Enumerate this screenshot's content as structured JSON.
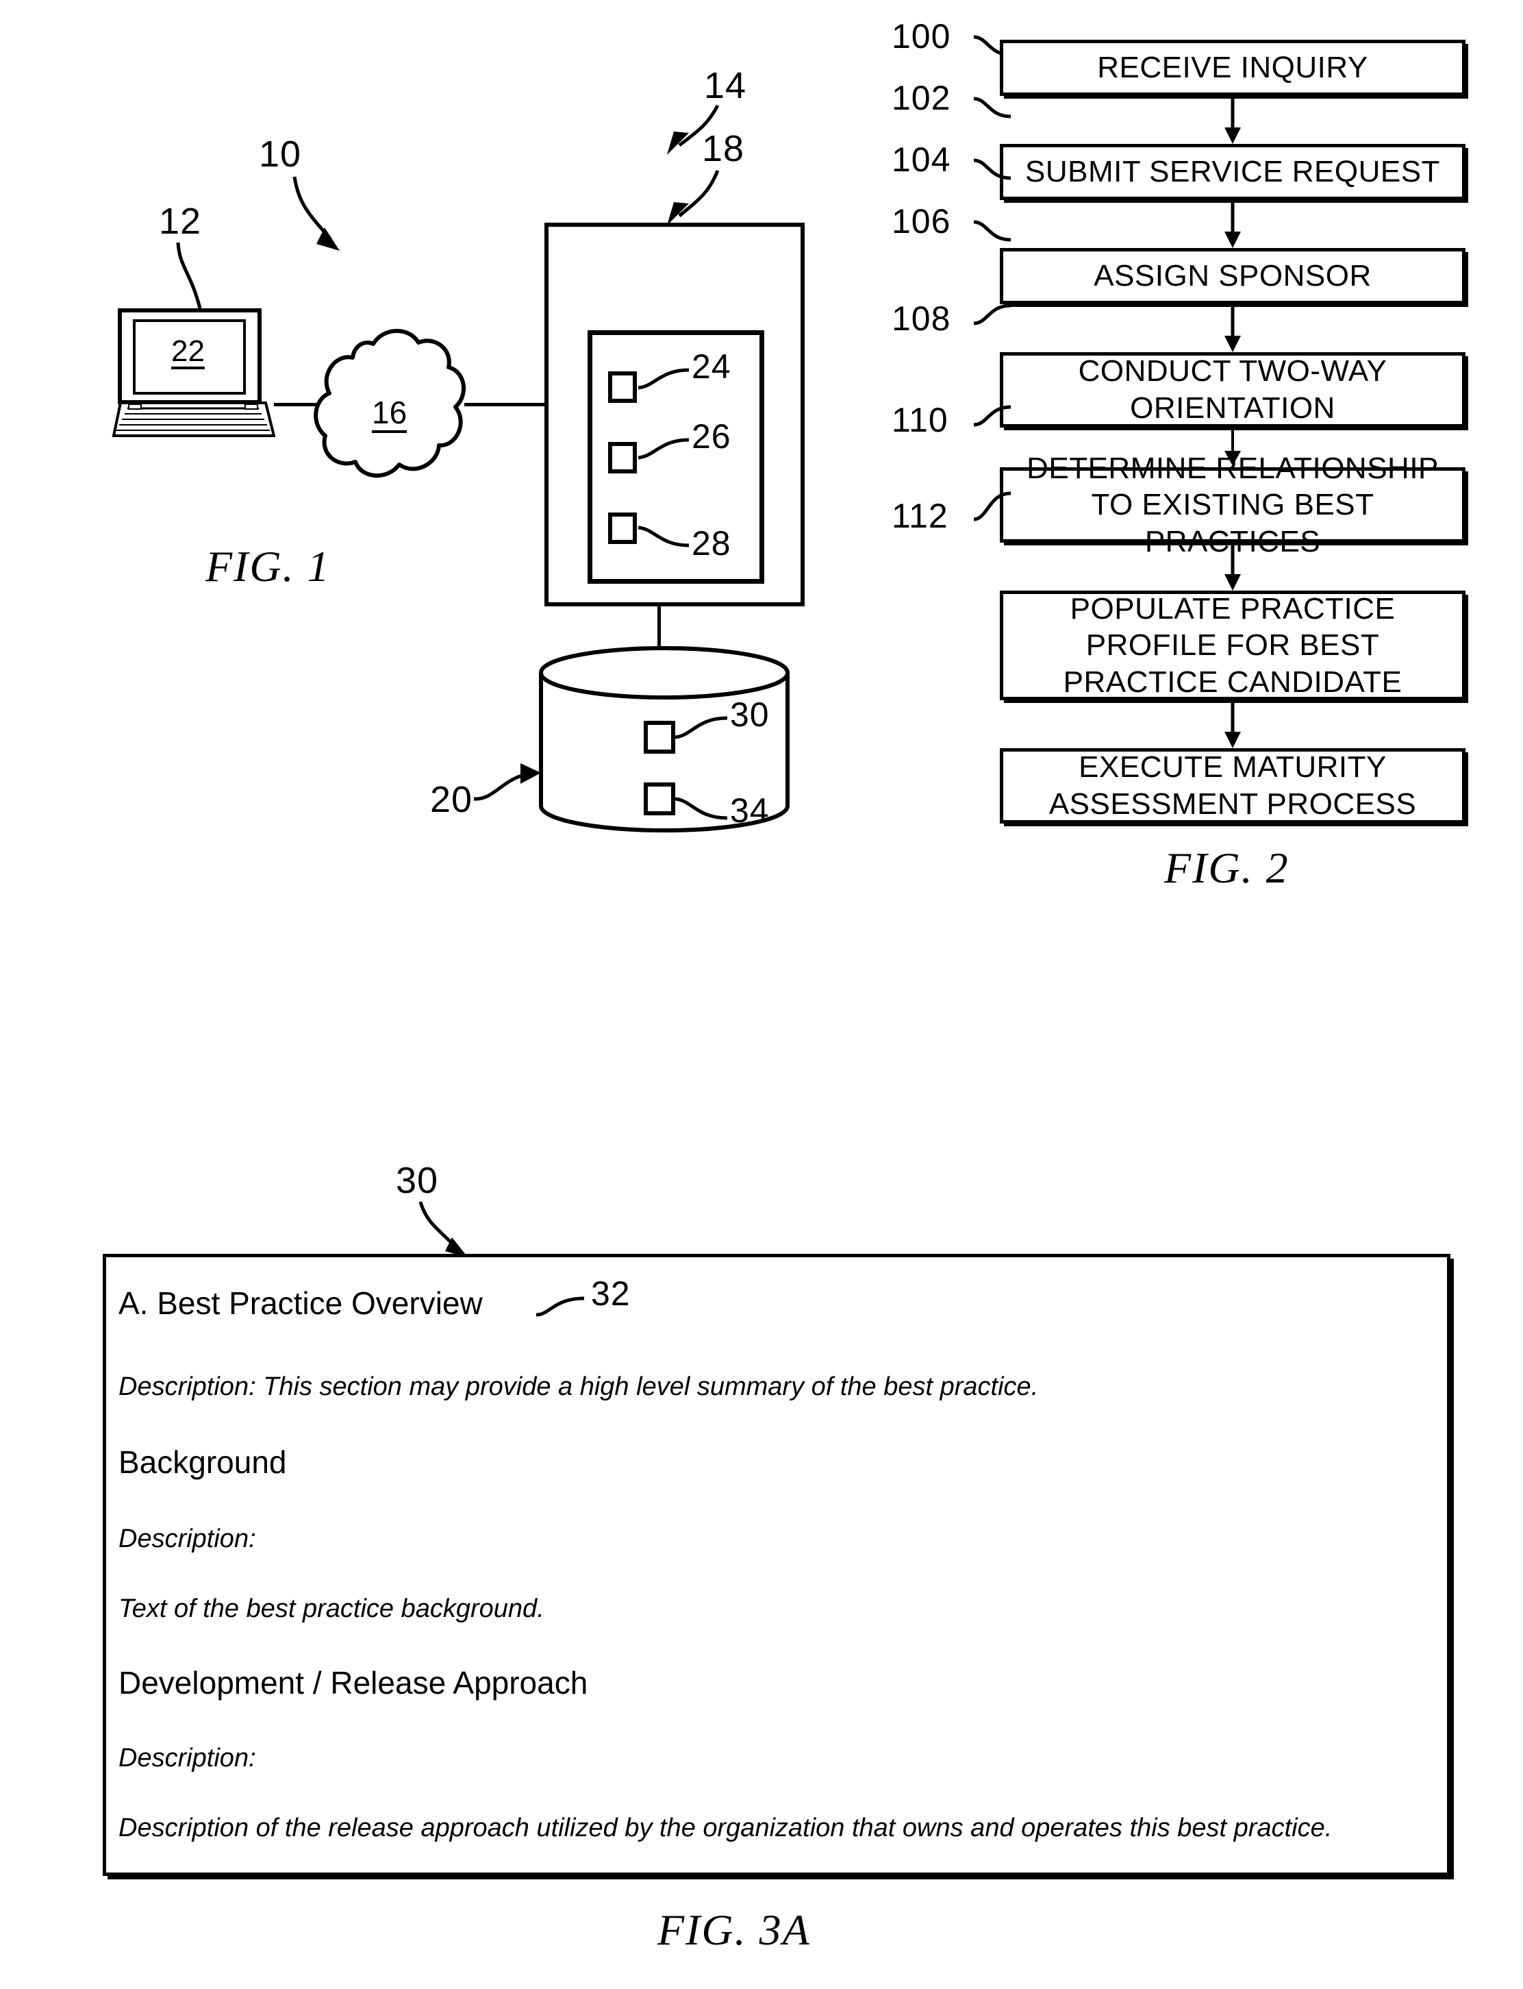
{
  "figures": {
    "fig1": {
      "caption": "FIG. 1",
      "refs": {
        "system": "10",
        "client": "12",
        "server": "14",
        "network": "16",
        "application": "18",
        "database": "20",
        "browser": "22",
        "module_a": "24",
        "module_b": "26",
        "module_c": "28",
        "record_a": "30",
        "record_b": "34"
      }
    },
    "fig2": {
      "caption": "FIG. 2",
      "steps": [
        {
          "ref": "100",
          "label": "RECEIVE INQUIRY"
        },
        {
          "ref": "102",
          "label": "SUBMIT SERVICE REQUEST"
        },
        {
          "ref": "104",
          "label": "ASSIGN SPONSOR"
        },
        {
          "ref": "106",
          "label": "CONDUCT TWO-WAY ORIENTATION"
        },
        {
          "ref": "108",
          "label": "DETERMINE RELATIONSHIP TO EXISTING BEST PRACTICES"
        },
        {
          "ref": "110",
          "label": "POPULATE PRACTICE PROFILE FOR BEST PRACTICE CANDIDATE"
        },
        {
          "ref": "112",
          "label": "EXECUTE MATURITY ASSESSMENT PROCESS"
        }
      ]
    },
    "fig3a": {
      "caption": "FIG. 3A",
      "refs": {
        "profile": "30",
        "section": "32"
      },
      "lines": [
        {
          "kind": "heading",
          "text": "A. Best Practice Overview"
        },
        {
          "kind": "body",
          "text": "Description: This section may provide a high level summary of the best practice."
        },
        {
          "kind": "heading",
          "text": "Background"
        },
        {
          "kind": "body",
          "text": "Description:"
        },
        {
          "kind": "body",
          "text": "Text of the best practice background."
        },
        {
          "kind": "heading",
          "text": "Development / Release Approach"
        },
        {
          "kind": "body",
          "text": "Description:"
        },
        {
          "kind": "body",
          "text": "Description of the release approach utilized by the organization that owns and operates this best practice."
        }
      ]
    }
  },
  "colors": {
    "ink": "#000000",
    "paper": "#ffffff"
  }
}
